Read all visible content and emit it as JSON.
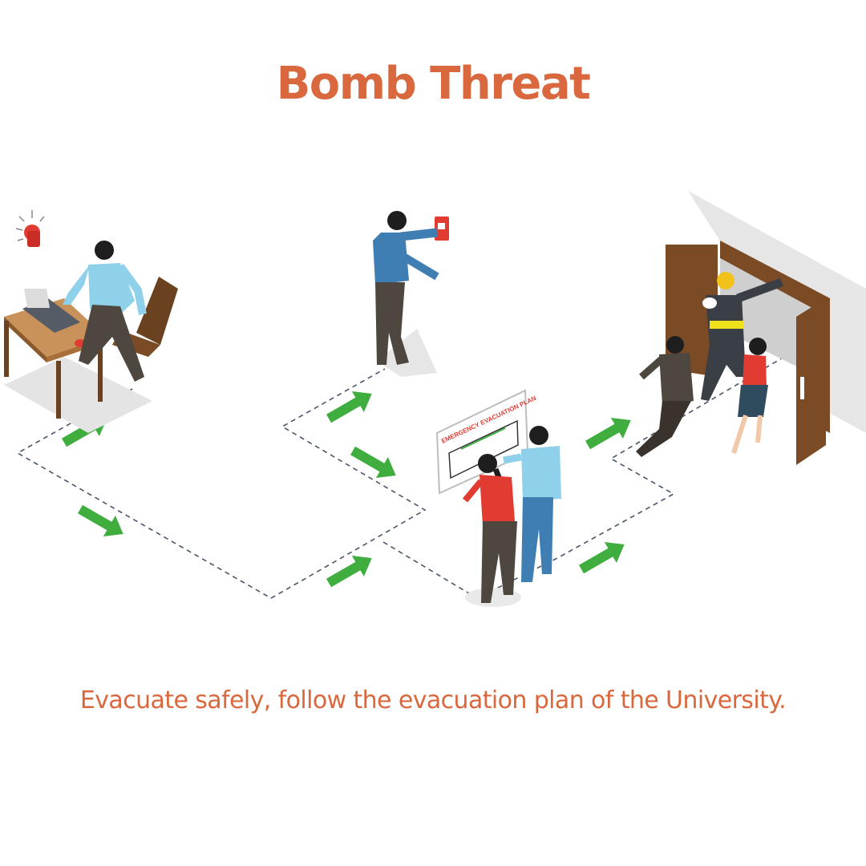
{
  "title": "Bomb Threat",
  "caption": "Evacuate safely, follow the evacuation plan of the University.",
  "sign_text": "EMERGENCY EVACUATION PLAN",
  "colors": {
    "title": "#d9683e",
    "caption": "#d9683e",
    "arrow": "#3fae3f",
    "path_dash": "#4a5668",
    "door": "#7a4b25",
    "alarm_red": "#e23b32"
  },
  "icons": [
    "alarm-bell-icon",
    "fire-alarm-switch-icon",
    "evacuation-plan-sign",
    "exit-door-icon",
    "arrow-icon"
  ]
}
